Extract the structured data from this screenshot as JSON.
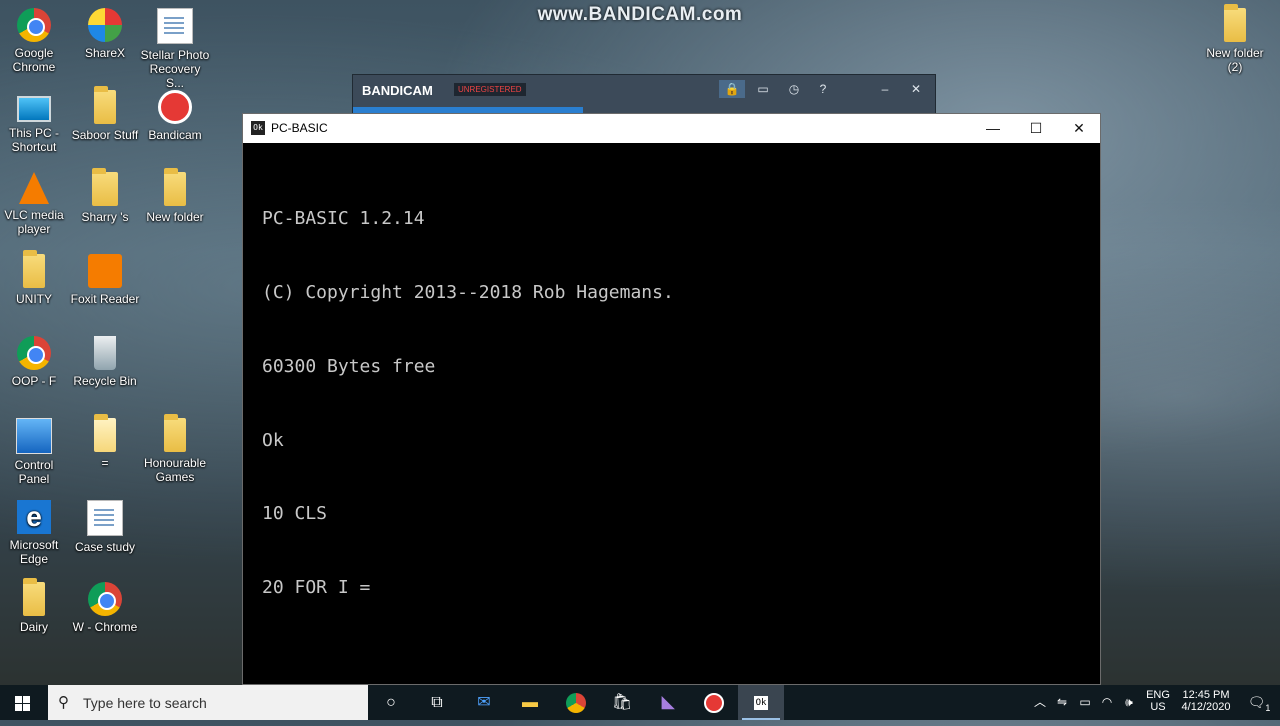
{
  "watermark": "www.BANDICAM.com",
  "desktop": {
    "icons": [
      {
        "label": "Google Chrome",
        "kind": "chrome"
      },
      {
        "label": "ShareX",
        "kind": "sharex"
      },
      {
        "label": "Stellar Photo Recovery S...",
        "kind": "stellar"
      },
      {
        "label": "This PC - Shortcut",
        "kind": "pc"
      },
      {
        "label": "Saboor Stuff",
        "kind": "folder"
      },
      {
        "label": "Bandicam",
        "kind": "bandicam"
      },
      {
        "label": "VLC media player",
        "kind": "vlc"
      },
      {
        "label": "Sharry 's",
        "kind": "folder-user"
      },
      {
        "label": "New folder",
        "kind": "folder"
      },
      {
        "label": "UNITY",
        "kind": "folder"
      },
      {
        "label": "Foxit Reader",
        "kind": "foxit"
      },
      {
        "label": "OOP - F",
        "kind": "chrome"
      },
      {
        "label": "Recycle Bin",
        "kind": "recycle"
      },
      {
        "label": "Control Panel",
        "kind": "control"
      },
      {
        "label": "=",
        "kind": "doc"
      },
      {
        "label": "Honourable Games",
        "kind": "folder"
      },
      {
        "label": "Microsoft Edge",
        "kind": "edge"
      },
      {
        "label": "Case study",
        "kind": "doc"
      },
      {
        "label": "Dairy",
        "kind": "folder"
      },
      {
        "label": "W - Chrome",
        "kind": "chrome"
      },
      {
        "label": "New folder (2)",
        "kind": "folder"
      }
    ]
  },
  "bandicam": {
    "brand": "BANDICAM",
    "badge": "UNREGISTERED",
    "icons": [
      "lock-icon",
      "folder-icon",
      "clock-icon",
      "help-icon",
      "minimize-icon",
      "close-icon"
    ]
  },
  "pcbasic_window": {
    "title": "PC-BASIC",
    "icon_text": "Ok",
    "controls": {
      "minimize": "—",
      "maximize": "☐",
      "close": "✕"
    },
    "terminal_lines": [
      "PC-BASIC 1.2.14",
      "(C) Copyright 2013--2018 Rob Hagemans.",
      "60300 Bytes free",
      "Ok",
      "10 CLS",
      "20 FOR I ="
    ]
  },
  "taskbar": {
    "search_placeholder": "Type here to search",
    "apps": [
      "cortana-icon",
      "task-view-icon",
      "mail-icon",
      "file-explorer-icon",
      "chrome-icon",
      "store-icon",
      "visual-studio-icon",
      "bandicam-icon",
      "pcbasic-icon"
    ],
    "language": "ENG",
    "region": "US",
    "time": "12:45 PM",
    "date": "4/12/2020",
    "notification_count": "1"
  }
}
